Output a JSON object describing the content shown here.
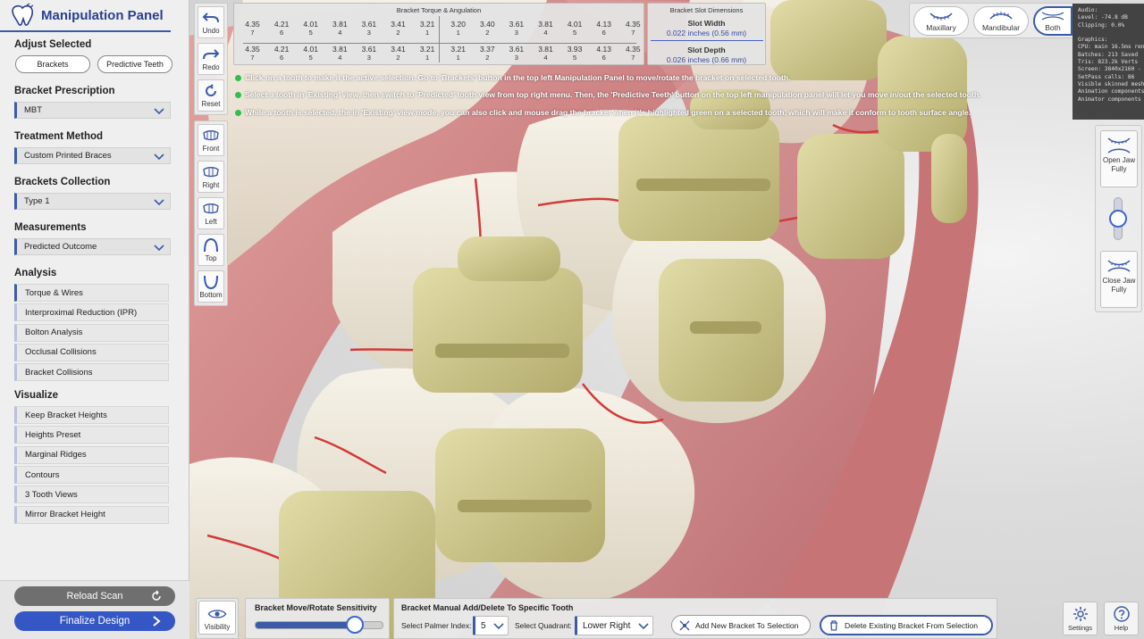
{
  "left_panel": {
    "title": "Manipulation Panel",
    "adjust_selected": {
      "title": "Adjust Selected",
      "brackets_label": "Brackets",
      "predictive_label": "Predictive Teeth"
    },
    "bracket_prescription": {
      "title": "Bracket Prescription",
      "value": "MBT"
    },
    "treatment_method": {
      "title": "Treatment Method",
      "value": "Custom Printed Braces"
    },
    "brackets_collection": {
      "title": "Brackets Collection",
      "value": "Type 1"
    },
    "measurements": {
      "title": "Measurements",
      "value": "Predicted Outcome"
    },
    "analysis": {
      "title": "Analysis",
      "items": [
        "Torque & Wires",
        "Interproximal Reduction (IPR)",
        "Bolton Analysis",
        "Occlusal Collisions",
        "Bracket Collisions"
      ]
    },
    "visualize": {
      "title": "Visualize",
      "items": [
        "Keep Bracket Heights",
        "Heights Preset",
        "Marginal Ridges",
        "Contours",
        "3 Tooth Views",
        "Mirror Bracket Height"
      ]
    },
    "reload_label": "Reload Scan",
    "finalize_label": "Finalize Design"
  },
  "toolbar": {
    "undo": "Undo",
    "redo": "Redo",
    "reset": "Reset"
  },
  "views": {
    "front": "Front",
    "right": "Right",
    "left": "Left",
    "top": "Top",
    "bottom": "Bottom"
  },
  "torque": {
    "title": "Bracket Torque & Angulation",
    "rows": [
      {
        "values": [
          "4.35",
          "4.21",
          "4.01",
          "3.81",
          "3.61",
          "3.41",
          "3.21",
          "3.20",
          "3.40",
          "3.61",
          "3.81",
          "4.01",
          "4.13",
          "4.35"
        ],
        "indices": [
          "7",
          "6",
          "5",
          "4",
          "3",
          "2",
          "1",
          "1",
          "2",
          "3",
          "4",
          "5",
          "6",
          "7"
        ]
      },
      {
        "values": [
          "4.35",
          "4.21",
          "4.01",
          "3.81",
          "3.61",
          "3.41",
          "3.21",
          "3.21",
          "3.37",
          "3.61",
          "3.81",
          "3.93",
          "4.13",
          "4.35"
        ],
        "indices": [
          "7",
          "6",
          "5",
          "4",
          "3",
          "2",
          "1",
          "1",
          "2",
          "3",
          "4",
          "5",
          "6",
          "7"
        ]
      }
    ]
  },
  "slot": {
    "title": "Bracket Slot Dimensions",
    "width_label": "Slot Width",
    "width_value": "0.022 inches (0.56 mm)",
    "depth_label": "Slot Depth",
    "depth_value": "0.026 inches (0.66 mm)"
  },
  "instructions": [
    "Click on a tooth to make it the active selection. Go to 'Brackets' button in the top left Manipulation Panel to move/rotate the bracket on selected tooth.",
    "Select a tooth in 'Existing' view, then switch to 'Predicted' tooth view from top right menu. Then, the 'Predictive Teeth' button on the top left manipulation panel will let you move in/out the selected tooth.",
    "While a tooth is selected, the in 'Existing' view mode, you can also click and mouse drag the bracket when it's highlighted green on a selected tooth, which will make it conform to tooth surface angle."
  ],
  "jaw_selector": {
    "maxillary": "Maxillary",
    "mandibular": "Mandibular",
    "both": "Both",
    "active": "Both"
  },
  "stats": {
    "lines": [
      "Audio:",
      "Level: -74.8 dB",
      "Clipping: 0.0%",
      "",
      "Graphics:",
      "CPU: main 16.5ms ren",
      "Batches: 213   Saved",
      "Tris: 823.2k   Verts",
      "Screen: 3840x2160 - 5",
      "SetPass calls: 86",
      "Visible skinned meshes",
      "Animation components",
      "Animator components"
    ]
  },
  "jaw_control": {
    "open_label": "Open Jaw Fully",
    "close_label": "Close Jaw Fully",
    "jaw_opening": 0.5
  },
  "bottom": {
    "visibility_label": "Visibility",
    "sensitivity_title": "Bracket Move/Rotate Sensitivity",
    "sensitivity_value": 0.78,
    "manual_title": "Bracket Manual Add/Delete To Specific Tooth",
    "palmer_label": "Select Palmer Index:",
    "palmer_value": "5",
    "quadrant_label": "Select Quadrant:",
    "quadrant_value": "Lower Right",
    "add_label": "Add New Bracket To Selection",
    "delete_label": "Delete Existing Bracket From Selection",
    "settings_label": "Settings",
    "help_label": "Help"
  },
  "colors": {
    "accent": "#3b5aa8",
    "finalize": "#3557c5",
    "bracket": "#cbc48a",
    "gum": "#c97a7a",
    "tooth": "#efeadf",
    "indicator": "#2fbf4a"
  }
}
